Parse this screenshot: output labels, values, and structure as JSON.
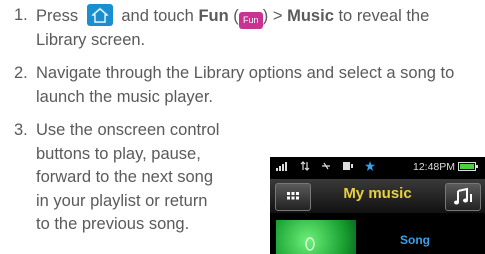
{
  "steps": [
    {
      "number": "1.",
      "part1": "Press",
      "part2": "and touch",
      "fun_bold": "Fun",
      "paren_open": "(",
      "fun_icon_label": "Fun",
      "paren_close": ") >",
      "music_bold": "Music",
      "part3": "to reveal the Library screen."
    },
    {
      "number": "2.",
      "text": "Navigate through the Library options and select a song to launch the music player."
    },
    {
      "number": "3.",
      "line1": "Use the onscreen control",
      "line2": "buttons to play, pause,",
      "line3": "forward to the next song",
      "line4": "in your playlist or return",
      "line5": "to the previous song."
    }
  ],
  "icons": {
    "home": "home-icon",
    "fun": "fun-app-icon"
  },
  "phone": {
    "status_time": "12:48PM",
    "status_icons": [
      "signal-icon",
      "network-icon",
      "usb-icon",
      "bluetooth-icon"
    ],
    "title": "My music",
    "song_label": "Song"
  },
  "colors": {
    "text": "#5a5a5a",
    "home_icon": "#1a8fd0",
    "fun_icon": "#c8338f",
    "title_yellow": "#e8d040",
    "song_blue": "#3aa0e8"
  }
}
